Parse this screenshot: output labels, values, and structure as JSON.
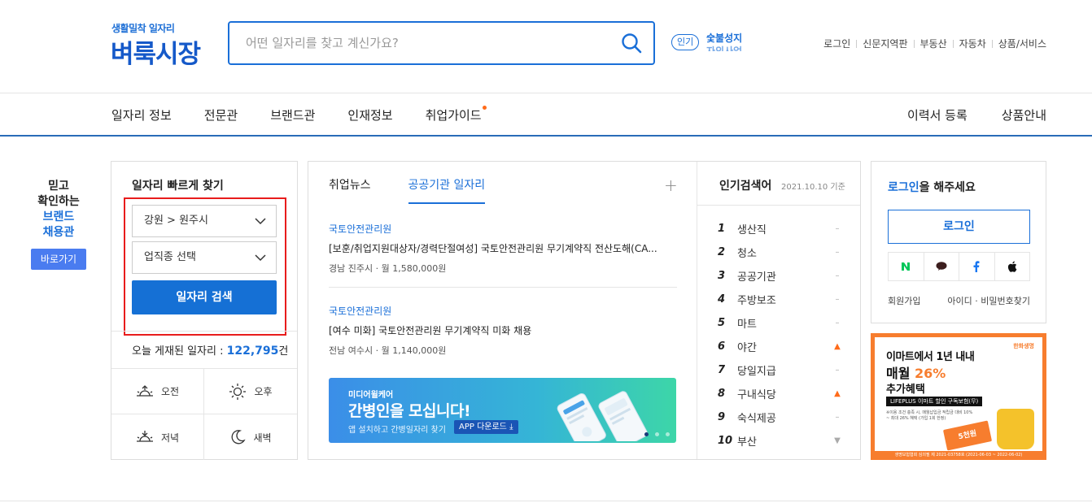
{
  "header": {
    "logo_small": "생활밀착 일자리",
    "logo_big": "벼룩시장",
    "search_placeholder": "어떤 일자리를 찾고 계신가요?",
    "popular_badge": "인기",
    "popular_ticker": [
      "숯불성지",
      "자의사업"
    ],
    "util_links": [
      "로그인",
      "신문지역판",
      "부동산",
      "자동차",
      "상품/서비스"
    ]
  },
  "nav": {
    "items": [
      "일자리 정보",
      "전문관",
      "브랜드관",
      "인재정보",
      "취업가이드"
    ],
    "right_items": [
      "이력서 등록",
      "상품안내"
    ]
  },
  "brand_side": {
    "line1": "믿고",
    "line2": "확인하는",
    "line3": "브랜드",
    "line4": "채용관",
    "button": "바로가기"
  },
  "quick_search": {
    "title": "일자리 빠르게 찾기",
    "region_value": "강원 > 원주시",
    "job_value": "업직종 선택",
    "search_button": "일자리 검색",
    "today_label": "오늘 게재된 일자리 :",
    "today_count": "122,795",
    "today_unit": "건",
    "times": [
      "오전",
      "오후",
      "저녁",
      "새벽"
    ]
  },
  "news": {
    "tabs": [
      "취업뉴스",
      "공공기관 일자리"
    ],
    "active_tab": 1,
    "plus": "+",
    "items": [
      {
        "org": "국토안전관리원",
        "title": "[보훈/취업지원대상자/경력단절여성] 국토안전관리원 무기계약직 전산도해(CA...",
        "location": "경남 진주시",
        "salary": "월 1,580,000원"
      },
      {
        "org": "국토안전관리원",
        "title": "[여수 미화] 국토안전관리원 무기계약직 미화 채용",
        "location": "전남 여수시",
        "salary": "월 1,140,000원"
      }
    ],
    "banner": {
      "small": "미디어윌케어",
      "big": "간병인을 모십니다!",
      "desc": "앱 설치하고 간병일자리 찾기",
      "app_button": "APP 다운로드"
    }
  },
  "popular": {
    "title": "인기검색어",
    "date": "2021.10.10 기준",
    "rows": [
      {
        "rank": "1",
        "keyword": "생산직",
        "trend": "same"
      },
      {
        "rank": "2",
        "keyword": "청소",
        "trend": "same"
      },
      {
        "rank": "3",
        "keyword": "공공기관",
        "trend": "same"
      },
      {
        "rank": "4",
        "keyword": "주방보조",
        "trend": "same"
      },
      {
        "rank": "5",
        "keyword": "마트",
        "trend": "same"
      },
      {
        "rank": "6",
        "keyword": "야간",
        "trend": "up"
      },
      {
        "rank": "7",
        "keyword": "당일지급",
        "trend": "same"
      },
      {
        "rank": "8",
        "keyword": "구내식당",
        "trend": "up"
      },
      {
        "rank": "9",
        "keyword": "숙식제공",
        "trend": "same"
      },
      {
        "rank": "10",
        "keyword": "부산",
        "trend": "down"
      }
    ]
  },
  "login": {
    "msg_highlight": "로그인",
    "msg_rest": "을 해주세요",
    "button": "로그인",
    "sns": [
      "naver-icon",
      "kakao-icon",
      "facebook-icon",
      "apple-icon"
    ],
    "links": [
      "회원가입",
      "아이디 · 비밀번호찾기"
    ]
  },
  "ad": {
    "logo": "한화생명",
    "line1": "이마트에서 1년 내내",
    "line2_prefix": "매월 ",
    "line2_highlight": "26%",
    "line3": "추가혜택",
    "bar": "LIFEPLUS 이마트 할인 구독보험(무)",
    "fine": "※이용 조건 충족 시, 매월납입금 적립금 대비 10% ~ 최대 26% 혜택 (가입 1회 한정)",
    "tag_main": "5천원",
    "tag_small": "가입 축하 이마트 상품권",
    "footer": "생명보험협회 심의필 제 2021-03758호 (2021-06-03 ~ 2022-06-02)"
  },
  "colors": {
    "primary": "#1a6fd8",
    "brand_button": "#4a7cf0",
    "highlight_frame": "#e81c1c",
    "ad_orange": "#f77d2e"
  }
}
